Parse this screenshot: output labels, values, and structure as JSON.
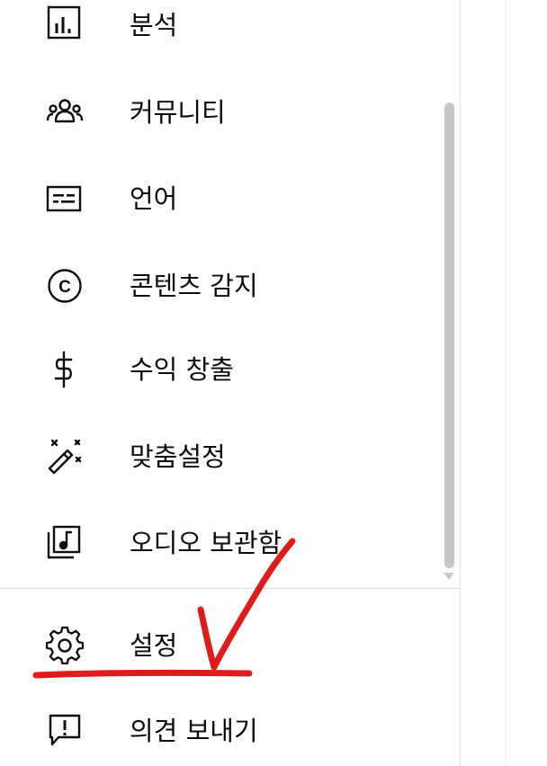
{
  "sidebar": {
    "items": [
      {
        "label": "분석",
        "icon": "analytics-icon"
      },
      {
        "label": "커뮤니티",
        "icon": "community-icon"
      },
      {
        "label": "언어",
        "icon": "subtitles-icon"
      },
      {
        "label": "콘텐츠 감지",
        "icon": "copyright-icon"
      },
      {
        "label": "수익 창출",
        "icon": "dollar-icon"
      },
      {
        "label": "맞춤설정",
        "icon": "magic-wand-icon"
      },
      {
        "label": "오디오 보관함",
        "icon": "audio-library-icon"
      }
    ],
    "footer_items": [
      {
        "label": "설정",
        "icon": "gear-icon"
      },
      {
        "label": "의견 보내기",
        "icon": "feedback-icon"
      }
    ]
  },
  "annotation": {
    "color": "#e01b1b",
    "marks": [
      "checkmark",
      "underline"
    ]
  }
}
